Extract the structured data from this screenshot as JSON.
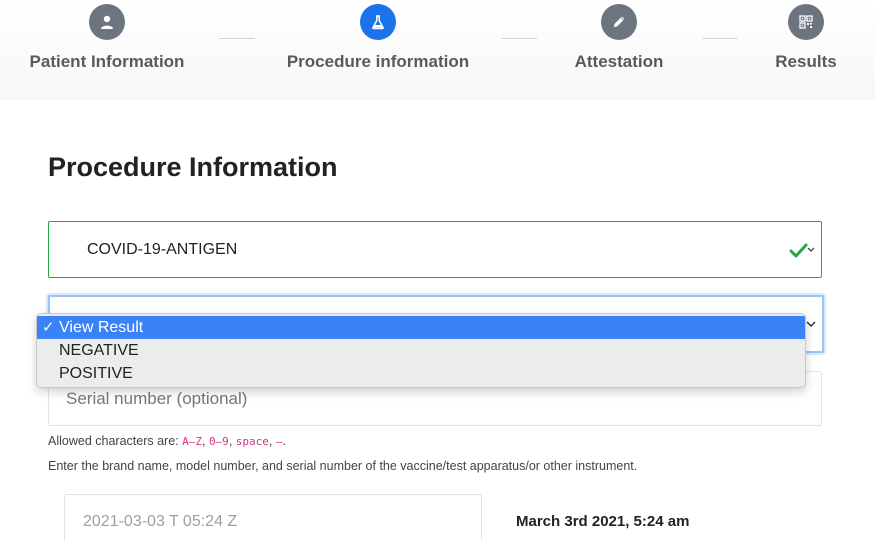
{
  "stepper": {
    "steps": [
      {
        "label": "Patient Information",
        "icon": "user-icon",
        "active": false
      },
      {
        "label": "Procedure information",
        "icon": "flask-icon",
        "active": true
      },
      {
        "label": "Attestation",
        "icon": "pencil-icon",
        "active": false
      },
      {
        "label": "Results",
        "icon": "qr-code-icon",
        "active": false
      }
    ]
  },
  "colors": {
    "active_step": "#1a73e8",
    "inactive_step": "#6c757d",
    "valid": "#28a745",
    "dropdown_selected": "#3b82f6"
  },
  "page": {
    "title": "Procedure Information"
  },
  "procedure_select": {
    "value": "COVID-19-ANTIGEN",
    "valid": true
  },
  "result_select": {
    "options": [
      {
        "label": "View Result",
        "selected": true
      },
      {
        "label": "NEGATIVE",
        "selected": false
      },
      {
        "label": "POSITIVE",
        "selected": false
      }
    ],
    "check_mark": "✓"
  },
  "serial": {
    "placeholder": "Serial number (optional)"
  },
  "help": {
    "allowed_prefix": "Allowed characters are:",
    "allowed_tokens": [
      "A–Z",
      "0–9",
      "space",
      "–"
    ],
    "instructions": "Enter the brand name, model number, and serial number of the vaccine/test apparatus/or other instrument."
  },
  "datetime": {
    "placeholder": "2021-03-03 T 05:24 Z",
    "display": "March 3rd 2021, 5:24 am"
  }
}
